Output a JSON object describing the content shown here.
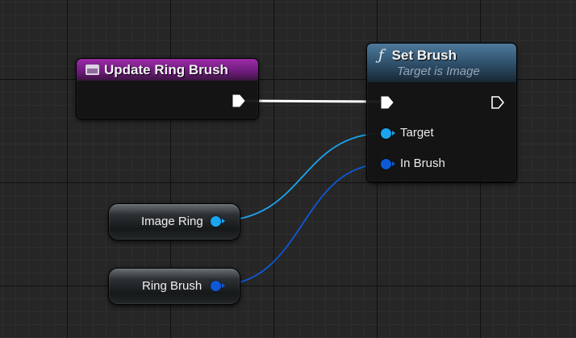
{
  "event_node": {
    "title": "Update Ring Brush",
    "icon": "event-graph-icon",
    "header_color": "#7b2188"
  },
  "function_node": {
    "title": "Set Brush",
    "subtitle": "Target is Image",
    "icon_glyph": "ƒ",
    "icon": "function-icon",
    "header_color": "#3d607c",
    "pins": {
      "target": "Target",
      "in_brush": "In Brush"
    }
  },
  "variables": {
    "image_ring": {
      "label": "Image Ring",
      "pin_color": "#1ba4f0"
    },
    "ring_brush": {
      "label": "Ring Brush",
      "pin_color": "#0d59d6"
    }
  },
  "colors": {
    "exec_wire": "#ffffff",
    "object_wire": "#1ba4f0",
    "struct_wire": "#0d59d6"
  }
}
